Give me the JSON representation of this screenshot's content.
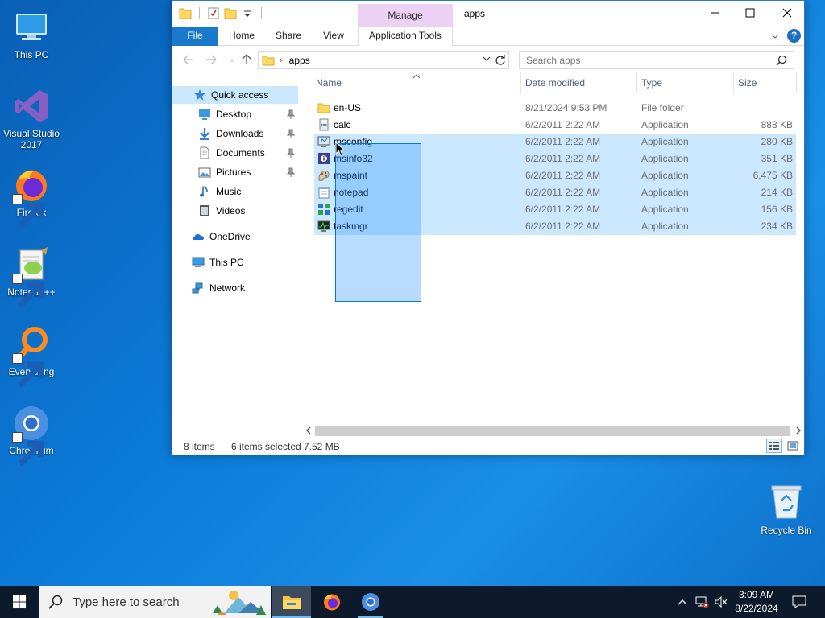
{
  "desktop": {
    "icons": [
      {
        "label": "This PC",
        "icon": "this-pc-icon"
      },
      {
        "label": "Visual Studio 2017",
        "icon": "visual-studio-icon"
      },
      {
        "label": "Firefox",
        "icon": "firefox-icon"
      },
      {
        "label": "Notepad++",
        "icon": "notepad-plus-plus-icon"
      },
      {
        "label": "Everything",
        "icon": "everything-icon"
      },
      {
        "label": "Chromium",
        "icon": "chromium-icon"
      }
    ],
    "recycle_bin": "Recycle Bin"
  },
  "window": {
    "title": "apps",
    "contextual_tab_group": "Manage",
    "ribbon_tabs": [
      "File",
      "Home",
      "Share",
      "View",
      "Application Tools"
    ],
    "address": {
      "path": "apps"
    },
    "search_placeholder": "Search apps",
    "nav": {
      "quick_access": "Quick access",
      "pinned": [
        "Desktop",
        "Downloads",
        "Documents",
        "Pictures"
      ],
      "items": [
        "Music",
        "Videos"
      ],
      "onedrive": "OneDrive",
      "this_pc": "This PC",
      "network": "Network"
    },
    "columns": {
      "name": "Name",
      "date": "Date modified",
      "type": "Type",
      "size": "Size"
    },
    "files": [
      {
        "name": "en-US",
        "date": "8/21/2024 9:53 PM",
        "type": "File folder",
        "size": "",
        "selected": false,
        "icon": "folder-icon"
      },
      {
        "name": "calc",
        "date": "6/2/2011 2:22 AM",
        "type": "Application",
        "size": "888 KB",
        "selected": false,
        "icon": "calc-icon"
      },
      {
        "name": "msconfig",
        "date": "6/2/2011 2:22 AM",
        "type": "Application",
        "size": "280 KB",
        "selected": true,
        "icon": "msconfig-icon"
      },
      {
        "name": "msinfo32",
        "date": "6/2/2011 2:22 AM",
        "type": "Application",
        "size": "351 KB",
        "selected": true,
        "icon": "msinfo32-icon"
      },
      {
        "name": "mspaint",
        "date": "6/2/2011 2:22 AM",
        "type": "Application",
        "size": "6,475 KB",
        "selected": true,
        "icon": "mspaint-icon"
      },
      {
        "name": "notepad",
        "date": "6/2/2011 2:22 AM",
        "type": "Application",
        "size": "214 KB",
        "selected": true,
        "icon": "notepad-icon"
      },
      {
        "name": "regedit",
        "date": "6/2/2011 2:22 AM",
        "type": "Application",
        "size": "156 KB",
        "selected": true,
        "icon": "regedit-icon"
      },
      {
        "name": "taskmgr",
        "date": "6/2/2011 2:22 AM",
        "type": "Application",
        "size": "234 KB",
        "selected": true,
        "icon": "taskmgr-icon"
      }
    ],
    "status": {
      "item_count": "8 items",
      "selection": "6 items selected",
      "selection_size": "7.52 MB"
    }
  },
  "taskbar": {
    "search_placeholder": "Type here to search",
    "apps": [
      "file-explorer-icon",
      "firefox-icon",
      "chromium-icon"
    ],
    "time": "3:09 AM",
    "date": "8/22/2024"
  },
  "colors": {
    "accent": "#1979ca",
    "selection": "#cce8ff",
    "manage_tab": "#ecd1f4",
    "taskbar": "#0d1a2b"
  }
}
